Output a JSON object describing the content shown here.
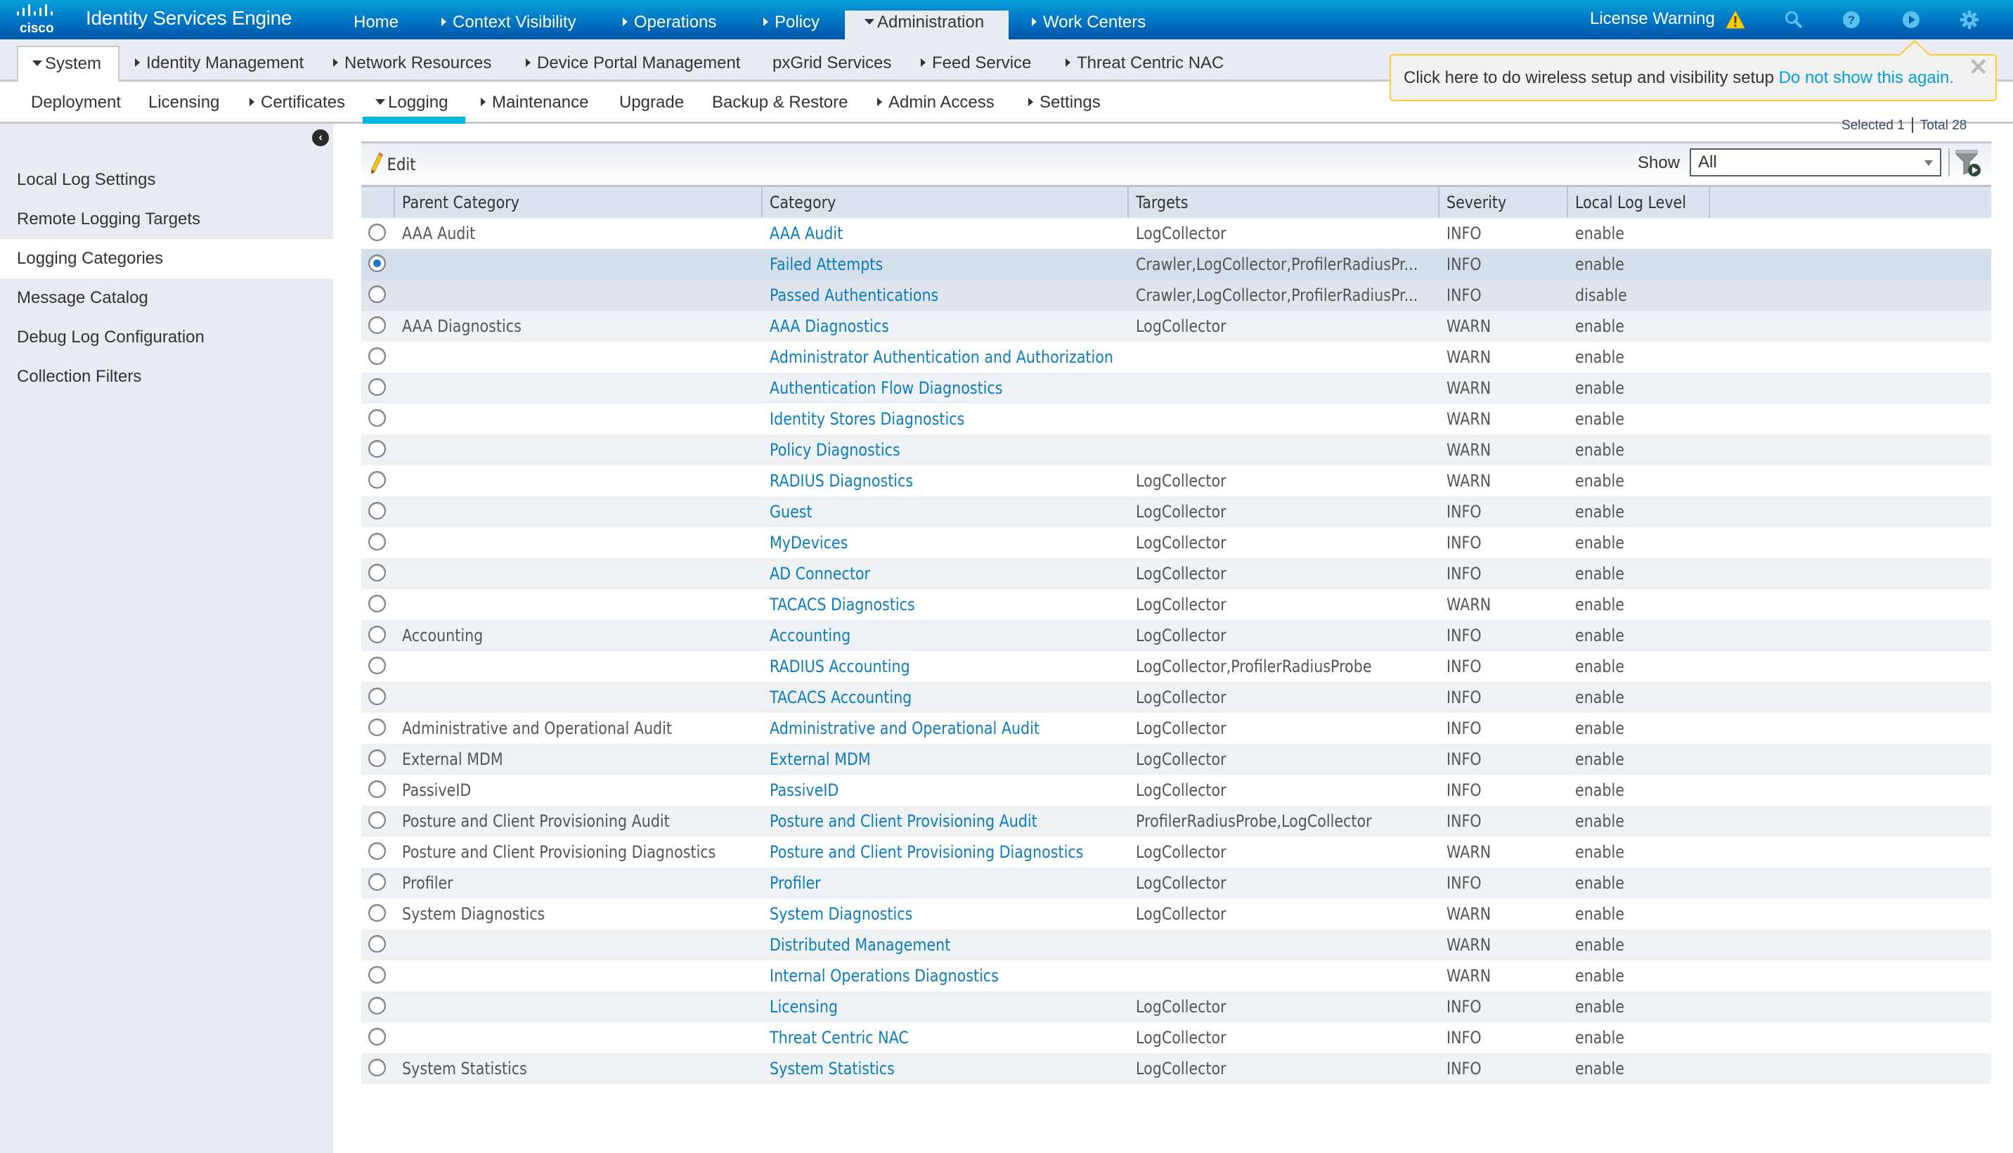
{
  "app": {
    "brand": "cisco",
    "title": "Identity Services Engine"
  },
  "topnav": {
    "items": [
      {
        "label": "Home",
        "arrow": "none"
      },
      {
        "label": "Context Visibility",
        "arrow": "right"
      },
      {
        "label": "Operations",
        "arrow": "right"
      },
      {
        "label": "Policy",
        "arrow": "right"
      },
      {
        "label": "Administration",
        "arrow": "down",
        "active": true
      },
      {
        "label": "Work Centers",
        "arrow": "right"
      }
    ],
    "license_warning": "License Warning",
    "icons": [
      "warning-icon",
      "search-icon",
      "help-icon",
      "play-icon",
      "gear-icon"
    ]
  },
  "subnav": {
    "items": [
      {
        "label": "System",
        "arrow": "down",
        "active": true
      },
      {
        "label": "Identity Management",
        "arrow": "right"
      },
      {
        "label": "Network Resources",
        "arrow": "right"
      },
      {
        "label": "Device Portal Management",
        "arrow": "right"
      },
      {
        "label": "pxGrid Services",
        "arrow": "none"
      },
      {
        "label": "Feed Service",
        "arrow": "right"
      },
      {
        "label": "Threat Centric NAC",
        "arrow": "right"
      }
    ]
  },
  "thirdnav": {
    "items": [
      {
        "label": "Deployment",
        "arrow": "none"
      },
      {
        "label": "Licensing",
        "arrow": "none"
      },
      {
        "label": "Certificates",
        "arrow": "right"
      },
      {
        "label": "Logging",
        "arrow": "down",
        "active": true
      },
      {
        "label": "Maintenance",
        "arrow": "right"
      },
      {
        "label": "Upgrade",
        "arrow": "none"
      },
      {
        "label": "Backup & Restore",
        "arrow": "none"
      },
      {
        "label": "Admin Access",
        "arrow": "right"
      },
      {
        "label": "Settings",
        "arrow": "right"
      }
    ]
  },
  "notification": {
    "message": "Click here to do wireless setup and visibility setup",
    "link": "Do not show this again.",
    "close": "✕"
  },
  "sidebar": {
    "collapse_icon": "‹",
    "items": [
      {
        "label": "Local Log Settings"
      },
      {
        "label": "Remote Logging Targets"
      },
      {
        "label": "Logging Categories",
        "active": true
      },
      {
        "label": "Message Catalog"
      },
      {
        "label": "Debug Log Configuration"
      },
      {
        "label": "Collection Filters"
      }
    ]
  },
  "status": {
    "selected": "Selected 1",
    "total": "Total 28"
  },
  "toolbar": {
    "edit_label": "Edit",
    "show_label": "Show",
    "show_value": "All"
  },
  "table": {
    "columns": [
      "Parent Category",
      "Category",
      "Targets",
      "Severity",
      "Local Log Level"
    ],
    "rows": [
      {
        "parent": "AAA Audit",
        "category": "AAA Audit",
        "targets": "LogCollector",
        "severity": "INFO",
        "level": "enable",
        "state": ""
      },
      {
        "parent": "",
        "category": "Failed Attempts",
        "targets": "Crawler,LogCollector,ProfilerRadiusPr...",
        "severity": "INFO",
        "level": "enable",
        "state": "selected"
      },
      {
        "parent": "",
        "category": "Passed Authentications",
        "targets": "Crawler,LogCollector,ProfilerRadiusPr...",
        "severity": "INFO",
        "level": "disable",
        "state": "hover"
      },
      {
        "parent": "AAA Diagnostics",
        "category": "AAA Diagnostics",
        "targets": "LogCollector",
        "severity": "WARN",
        "level": "enable",
        "state": ""
      },
      {
        "parent": "",
        "category": "Administrator Authentication and Authorization",
        "targets": "",
        "severity": "WARN",
        "level": "enable",
        "state": ""
      },
      {
        "parent": "",
        "category": "Authentication Flow Diagnostics",
        "targets": "",
        "severity": "WARN",
        "level": "enable",
        "state": ""
      },
      {
        "parent": "",
        "category": "Identity Stores Diagnostics",
        "targets": "",
        "severity": "WARN",
        "level": "enable",
        "state": ""
      },
      {
        "parent": "",
        "category": "Policy Diagnostics",
        "targets": "",
        "severity": "WARN",
        "level": "enable",
        "state": ""
      },
      {
        "parent": "",
        "category": "RADIUS Diagnostics",
        "targets": "LogCollector",
        "severity": "WARN",
        "level": "enable",
        "state": ""
      },
      {
        "parent": "",
        "category": "Guest",
        "targets": "LogCollector",
        "severity": "INFO",
        "level": "enable",
        "state": ""
      },
      {
        "parent": "",
        "category": "MyDevices",
        "targets": "LogCollector",
        "severity": "INFO",
        "level": "enable",
        "state": ""
      },
      {
        "parent": "",
        "category": "AD Connector",
        "targets": "LogCollector",
        "severity": "INFO",
        "level": "enable",
        "state": ""
      },
      {
        "parent": "",
        "category": "TACACS Diagnostics",
        "targets": "LogCollector",
        "severity": "WARN",
        "level": "enable",
        "state": ""
      },
      {
        "parent": "Accounting",
        "category": "Accounting",
        "targets": "LogCollector",
        "severity": "INFO",
        "level": "enable",
        "state": ""
      },
      {
        "parent": "",
        "category": "RADIUS Accounting",
        "targets": "LogCollector,ProfilerRadiusProbe",
        "severity": "INFO",
        "level": "enable",
        "state": ""
      },
      {
        "parent": "",
        "category": "TACACS Accounting",
        "targets": "LogCollector",
        "severity": "INFO",
        "level": "enable",
        "state": ""
      },
      {
        "parent": "Administrative and Operational Audit",
        "category": "Administrative and Operational Audit",
        "targets": "LogCollector",
        "severity": "INFO",
        "level": "enable",
        "state": ""
      },
      {
        "parent": "External MDM",
        "category": "External MDM",
        "targets": "LogCollector",
        "severity": "INFO",
        "level": "enable",
        "state": ""
      },
      {
        "parent": "PassiveID",
        "category": "PassiveID",
        "targets": "LogCollector",
        "severity": "INFO",
        "level": "enable",
        "state": ""
      },
      {
        "parent": "Posture and Client Provisioning Audit",
        "category": "Posture and Client Provisioning Audit",
        "targets": "ProfilerRadiusProbe,LogCollector",
        "severity": "INFO",
        "level": "enable",
        "state": ""
      },
      {
        "parent": "Posture and Client Provisioning Diagnostics",
        "category": "Posture and Client Provisioning Diagnostics",
        "targets": "LogCollector",
        "severity": "WARN",
        "level": "enable",
        "state": ""
      },
      {
        "parent": "Profiler",
        "category": "Profiler",
        "targets": "LogCollector",
        "severity": "INFO",
        "level": "enable",
        "state": ""
      },
      {
        "parent": "System Diagnostics",
        "category": "System Diagnostics",
        "targets": "LogCollector",
        "severity": "WARN",
        "level": "enable",
        "state": ""
      },
      {
        "parent": "",
        "category": "Distributed Management",
        "targets": "",
        "severity": "WARN",
        "level": "enable",
        "state": ""
      },
      {
        "parent": "",
        "category": "Internal Operations Diagnostics",
        "targets": "",
        "severity": "WARN",
        "level": "enable",
        "state": ""
      },
      {
        "parent": "",
        "category": "Licensing",
        "targets": "LogCollector",
        "severity": "INFO",
        "level": "enable",
        "state": ""
      },
      {
        "parent": "",
        "category": "Threat Centric NAC",
        "targets": "LogCollector",
        "severity": "INFO",
        "level": "enable",
        "state": ""
      },
      {
        "parent": "System Statistics",
        "category": "System Statistics",
        "targets": "LogCollector",
        "severity": "INFO",
        "level": "enable",
        "state": ""
      }
    ]
  },
  "colors": {
    "accent": "#049fd9",
    "link": "#0c7bbf",
    "warning": "#ffcc00",
    "tab_underline": "#00b5e2"
  }
}
